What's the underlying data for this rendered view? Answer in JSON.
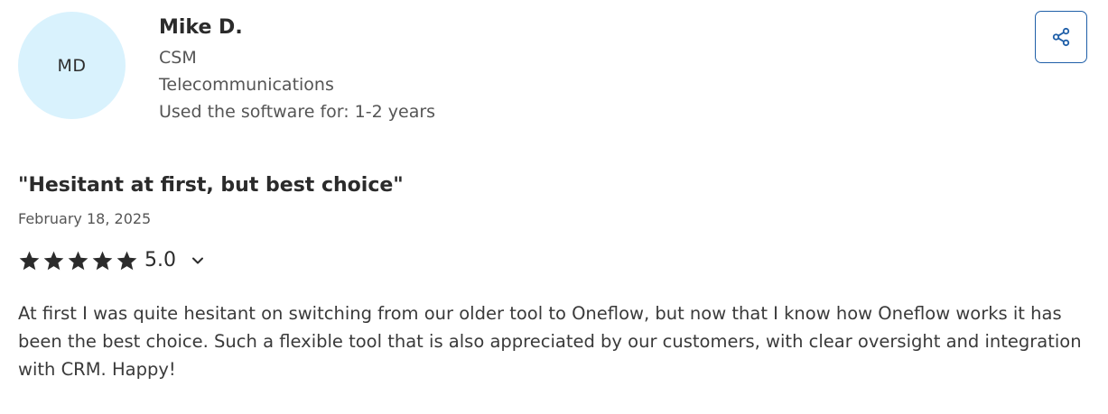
{
  "reviewer": {
    "initials": "MD",
    "name": "Mike D.",
    "role": "CSM",
    "industry": "Telecommunications",
    "usage": "Used the software for: 1-2 years"
  },
  "share": {
    "icon": "share-icon",
    "accent_color": "#1f5fa8"
  },
  "review": {
    "title": "\"Hesitant at first, but best choice\"",
    "date": "February 18, 2025",
    "rating": {
      "stars_filled": 5,
      "stars_total": 5,
      "value": "5.0",
      "star_color": "#2b2b2b"
    },
    "body": "At first I was quite hesitant on switching from our older tool to Oneflow, but now that I know how Oneflow works it has been the best choice. Such a flexible tool that is also appreciated by our customers, with clear oversight and integration with CRM. Happy!"
  },
  "colors": {
    "avatar_bg": "#d9f2fd"
  }
}
